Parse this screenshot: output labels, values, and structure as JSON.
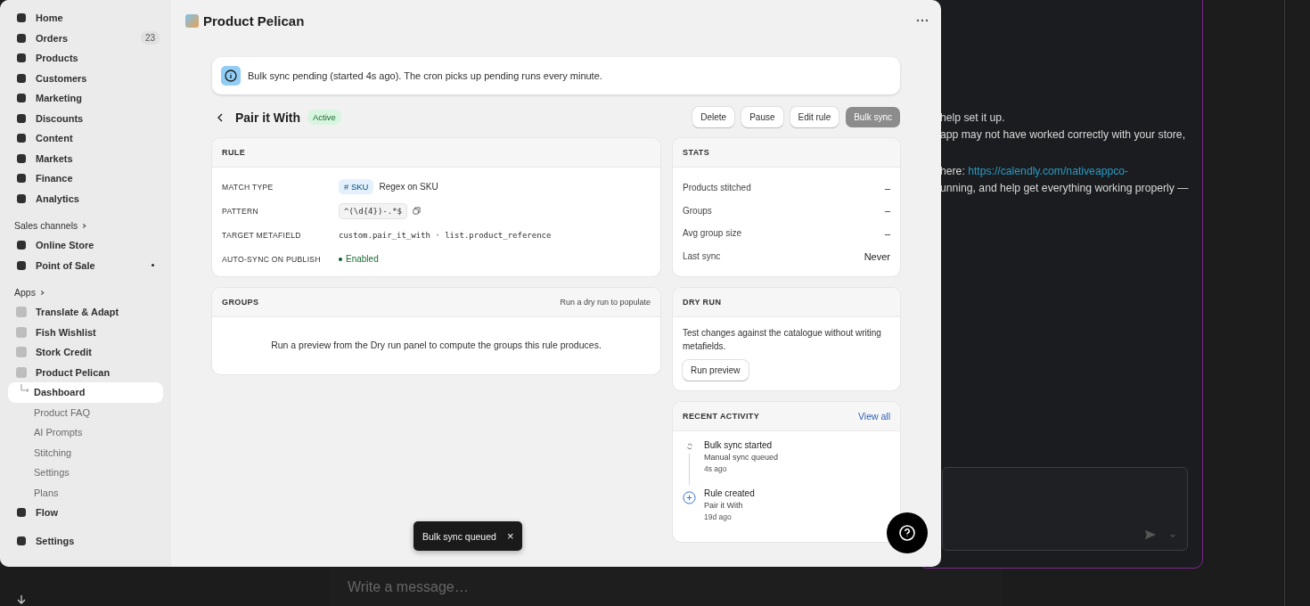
{
  "chat": {
    "lines": [
      {
        "text": "help set it up."
      },
      {
        "text": "app may not have worked correctly with your store,"
      },
      {
        "text": "here: ",
        "link": "https://calendly.com/nativeappco-"
      },
      {
        "text": "unning, and help get everything working properly —"
      }
    ],
    "composer_placeholder": "Write a message…"
  },
  "sidebar": [
    {
      "kind": "item",
      "label": "Home",
      "dot": false
    },
    {
      "kind": "item",
      "label": "Orders",
      "badge": "23",
      "dot": false
    },
    {
      "kind": "item",
      "label": "Products",
      "dot": false
    },
    {
      "kind": "item",
      "label": "Customers",
      "dot": false
    },
    {
      "kind": "item",
      "label": "Marketing",
      "dot": false
    },
    {
      "kind": "item",
      "label": "Discounts",
      "dot": false
    },
    {
      "kind": "item",
      "label": "Content",
      "dot": false
    },
    {
      "kind": "item",
      "label": "Markets",
      "dot": false
    },
    {
      "kind": "item",
      "label": "Finance",
      "dot": false
    },
    {
      "kind": "item",
      "label": "Analytics",
      "dot": false
    },
    {
      "kind": "heading",
      "label": "Sales channels"
    },
    {
      "kind": "item",
      "label": "Online Store",
      "dot": false
    },
    {
      "kind": "item",
      "label": "Point of Sale",
      "dot": true
    },
    {
      "kind": "heading",
      "label": "Apps"
    },
    {
      "kind": "app",
      "label": "Translate & Adapt"
    },
    {
      "kind": "app",
      "label": "Fish Wishlist"
    },
    {
      "kind": "app",
      "label": "Stork Credit"
    },
    {
      "kind": "app",
      "label": "Product Pelican",
      "children": [
        {
          "label": "Dashboard",
          "selected": true
        },
        {
          "label": "Product FAQ",
          "selected": false
        },
        {
          "label": "AI Prompts",
          "selected": false
        },
        {
          "label": "Stitching",
          "selected": false
        },
        {
          "label": "Settings",
          "selected": false
        },
        {
          "label": "Plans",
          "selected": false
        }
      ]
    },
    {
      "kind": "item",
      "label": "Flow",
      "dot": false
    },
    {
      "kind": "footer",
      "label": "Settings"
    }
  ],
  "app_title": "Product Pelican",
  "banner": "Bulk sync pending (started 4s ago). The cron picks up pending runs every minute.",
  "page": {
    "title": "Pair it With",
    "status": "Active",
    "buttons": [
      {
        "label": "Delete",
        "disabled": false
      },
      {
        "label": "Pause",
        "disabled": false
      },
      {
        "label": "Edit rule",
        "disabled": false
      },
      {
        "label": "Bulk sync",
        "disabled": true
      }
    ]
  },
  "rule": {
    "title": "RULE",
    "rows": [
      {
        "kind": "tag",
        "label": "MATCH TYPE",
        "prefix": "#",
        "tag": "SKU",
        "value": "Regex on SKU"
      },
      {
        "kind": "code",
        "label": "PATTERN",
        "value": "^(\\d{4})-.*$"
      },
      {
        "kind": "mono",
        "label": "TARGET METAFIELD",
        "value": "custom.pair_it_with · list.product_reference"
      },
      {
        "kind": "status",
        "label": "AUTO-SYNC ON PUBLISH",
        "value": "Enabled"
      }
    ]
  },
  "groups": {
    "title": "GROUPS",
    "action": "Run a dry run to populate",
    "empty": "Run a preview from the Dry run panel to compute the groups this rule produces."
  },
  "stats": {
    "title": "STATS",
    "rows": [
      {
        "label": "Products stitched",
        "value": "–"
      },
      {
        "label": "Groups",
        "value": "–"
      },
      {
        "label": "Avg group size",
        "value": "–"
      },
      {
        "label": "Last sync",
        "value": "Never"
      }
    ]
  },
  "dry_run": {
    "title": "DRY RUN",
    "text": "Test changes against the catalogue without writing metafields.",
    "button": "Run preview"
  },
  "activity": {
    "title": "RECENT ACTIVITY",
    "link": "View all",
    "items": [
      {
        "kind": "sync",
        "title": "Bulk sync started",
        "detail": "Manual sync queued",
        "time": "4s ago"
      },
      {
        "kind": "created",
        "title": "Rule created",
        "detail": "Pair it With",
        "time": "19d ago"
      }
    ]
  },
  "toast": {
    "text": "Bulk sync queued",
    "close": "×"
  }
}
